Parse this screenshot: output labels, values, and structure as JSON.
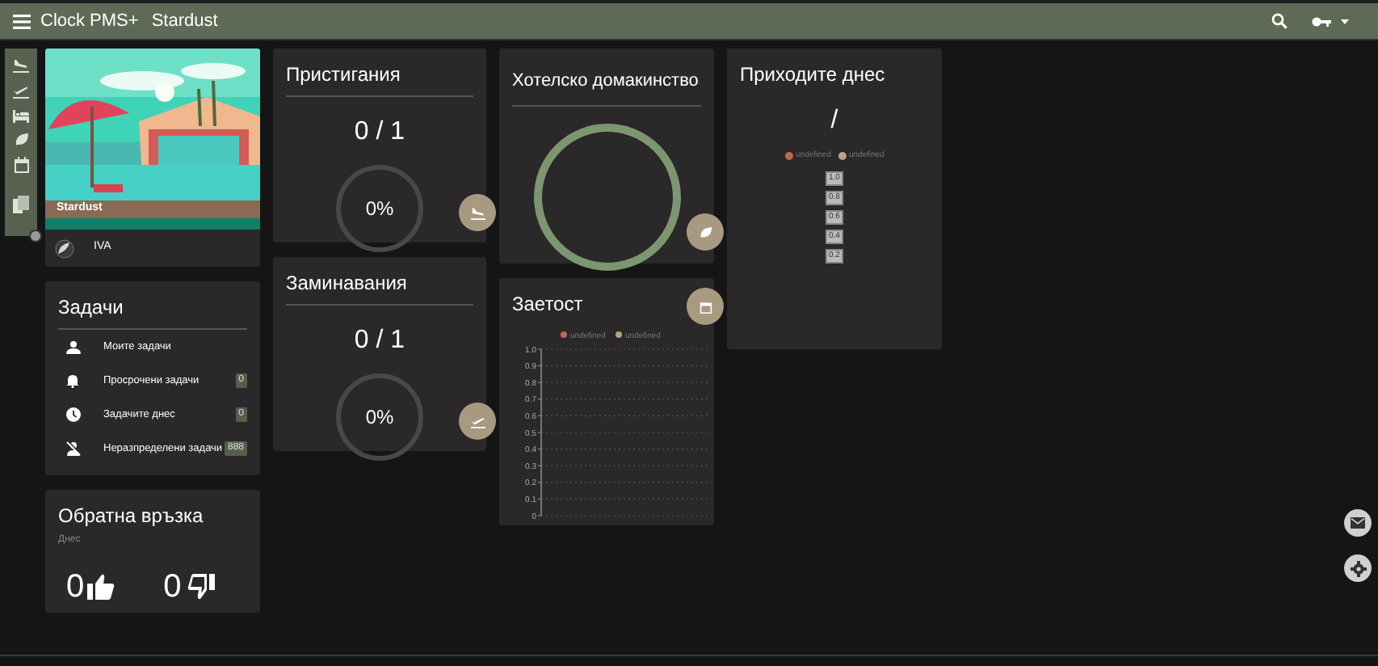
{
  "top_bar": {
    "app_title": "Clock PMS+",
    "property": "Stardust"
  },
  "hotel_card": {
    "name": "Stardust",
    "user": "IVA"
  },
  "tasks": {
    "title": "Задачи",
    "items": [
      {
        "kind": "mine",
        "label": "Моите задачи"
      },
      {
        "kind": "overdue",
        "label": "Просрочени задачи",
        "count": "0"
      },
      {
        "kind": "today",
        "label": "Задачите днес",
        "count": "0"
      },
      {
        "kind": "unassigned",
        "label": "Неразпределени задачи",
        "count": "888"
      }
    ]
  },
  "feedback": {
    "title": "Обратна връзка",
    "period": "Днес",
    "likes": "0",
    "dislikes": "0"
  },
  "arrivals": {
    "title": "Пристигания",
    "count": "0 / 1",
    "percent": "0%"
  },
  "departures": {
    "title": "Заминавания",
    "count": "0 / 1",
    "percent": "0%"
  },
  "housekeeping": {
    "title": "Хотелско домакинство"
  },
  "occupancy": {
    "title": "Заетост",
    "chart_data": {
      "type": "line",
      "series": [
        {
          "name": "undefined",
          "color": "#c0675a"
        },
        {
          "name": "undefined",
          "color": "#b5a484"
        }
      ],
      "grid": true,
      "ylim": [
        0,
        1
      ],
      "yticks": [
        {
          "value": 0,
          "label": "0"
        },
        {
          "value": 0.1,
          "label": "0.1"
        },
        {
          "value": 0.2,
          "label": "0.2"
        },
        {
          "value": 0.3,
          "label": "0.3"
        },
        {
          "value": 0.4,
          "label": "0.4"
        },
        {
          "value": 0.5,
          "label": "0.5"
        },
        {
          "value": 0.6,
          "label": "0.6"
        },
        {
          "value": 0.7,
          "label": "0.7"
        },
        {
          "value": 0.8,
          "label": "0.8"
        },
        {
          "value": 0.9,
          "label": "0.9"
        },
        {
          "value": 1,
          "label": "1.0"
        }
      ]
    }
  },
  "arrivals_today": {
    "title": "Приходите днес",
    "count": "/",
    "legend": [
      {
        "label": "undefined",
        "color": "#c0675a"
      },
      {
        "label": "undefined",
        "color": "#b5a484"
      }
    ],
    "scale_labels": [
      "1.0",
      "0.8",
      "0.6",
      "0.4",
      "0.2"
    ]
  }
}
